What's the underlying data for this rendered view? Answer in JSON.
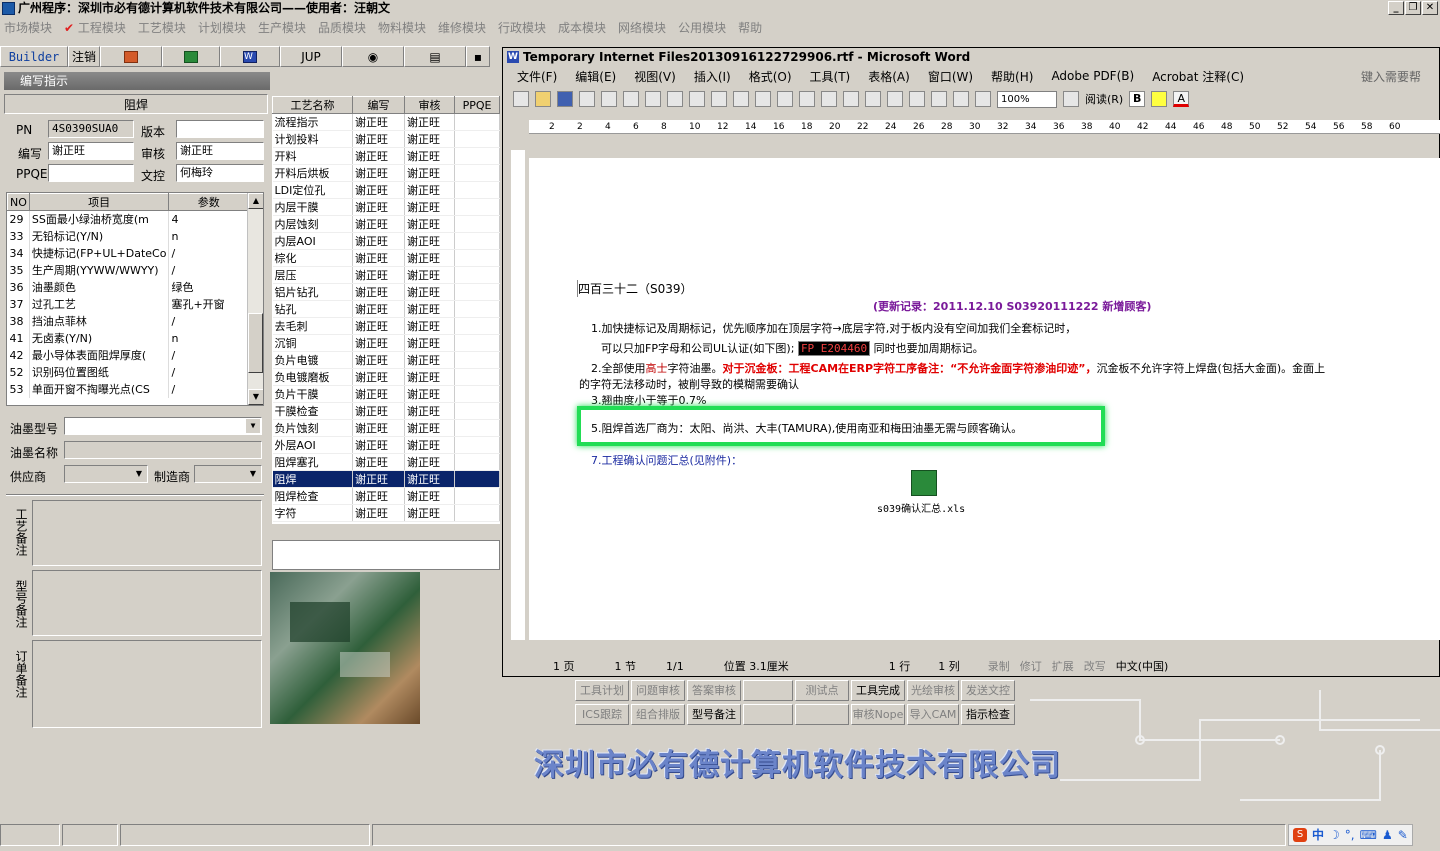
{
  "app": {
    "title": "广州程序：深圳市必有德计算机软件技术有限公司——使用者：汪朝文"
  },
  "menu": [
    "市场模块",
    "工程模块",
    "工艺模块",
    "计划模块",
    "生产模块",
    "品质模块",
    "物料模块",
    "维修模块",
    "行政模块",
    "成本模块",
    "网络模块",
    "公用模块",
    "帮助"
  ],
  "toolbar": {
    "builder": "Builder",
    "logout": "注销",
    "jup": "JUP"
  },
  "left": {
    "header": "编写指示",
    "section_title": "阻焊",
    "pn_label": "PN",
    "pn_value": "4S0390SUA0",
    "version_label": "版本",
    "version_value": "",
    "author_label": "编写",
    "author_value": "谢正旺",
    "review_label": "审核",
    "review_value": "谢正旺",
    "ppqe_label": "PPQE",
    "ppqe_value": "",
    "control_label": "文控",
    "control_value": "何梅玲",
    "param_cols": [
      "NO",
      "项目",
      "参数"
    ],
    "params": [
      {
        "no": "29",
        "item": "SS面最小绿油桥宽度(m",
        "val": "4"
      },
      {
        "no": "33",
        "item": "无铅标记(Y/N)",
        "val": "n"
      },
      {
        "no": "34",
        "item": "快捷标记(FP+UL+DateCo",
        "val": "/"
      },
      {
        "no": "35",
        "item": "生产周期(YYWW/WWYY)",
        "val": "/"
      },
      {
        "no": "36",
        "item": "油墨颜色",
        "val": "绿色"
      },
      {
        "no": "37",
        "item": "过孔工艺",
        "val": "塞孔+开窗"
      },
      {
        "no": "38",
        "item": "挡油点菲林",
        "val": "/"
      },
      {
        "no": "41",
        "item": "无卤素(Y/N)",
        "val": "n"
      },
      {
        "no": "42",
        "item": "最小导体表面阻焊厚度(",
        "val": "/"
      },
      {
        "no": "52",
        "item": "识别码位置图纸",
        "val": "/"
      },
      {
        "no": "53",
        "item": "单面开窗不掏曝光点(CS",
        "val": "/"
      }
    ],
    "ink_type_label": "油墨型号",
    "ink_name_label": "油墨名称",
    "supplier_label": "供应商",
    "maker_label": "制造商",
    "note1": "工艺备注",
    "note2": "型号备注",
    "note3": "订单备注"
  },
  "process": {
    "cols": [
      "工艺名称",
      "编写",
      "审核",
      "PPQE"
    ],
    "rows": [
      [
        "流程指示",
        "谢正旺",
        "谢正旺"
      ],
      [
        "计划投料",
        "谢正旺",
        "谢正旺"
      ],
      [
        "开料",
        "谢正旺",
        "谢正旺"
      ],
      [
        "开料后烘板",
        "谢正旺",
        "谢正旺"
      ],
      [
        "LDI定位孔",
        "谢正旺",
        "谢正旺"
      ],
      [
        "内层干膜",
        "谢正旺",
        "谢正旺"
      ],
      [
        "内层蚀刻",
        "谢正旺",
        "谢正旺"
      ],
      [
        "内层AOI",
        "谢正旺",
        "谢正旺"
      ],
      [
        "棕化",
        "谢正旺",
        "谢正旺"
      ],
      [
        "层压",
        "谢正旺",
        "谢正旺"
      ],
      [
        "铝片钻孔",
        "谢正旺",
        "谢正旺"
      ],
      [
        "钻孔",
        "谢正旺",
        "谢正旺"
      ],
      [
        "去毛刺",
        "谢正旺",
        "谢正旺"
      ],
      [
        "沉铜",
        "谢正旺",
        "谢正旺"
      ],
      [
        "负片电镀",
        "谢正旺",
        "谢正旺"
      ],
      [
        "负电镀磨板",
        "谢正旺",
        "谢正旺"
      ],
      [
        "负片干膜",
        "谢正旺",
        "谢正旺"
      ],
      [
        "干膜检查",
        "谢正旺",
        "谢正旺"
      ],
      [
        "负片蚀刻",
        "谢正旺",
        "谢正旺"
      ],
      [
        "外层AOI",
        "谢正旺",
        "谢正旺"
      ],
      [
        "阻焊塞孔",
        "谢正旺",
        "谢正旺"
      ],
      [
        "阻焊",
        "谢正旺",
        "谢正旺"
      ],
      [
        "阻焊检查",
        "谢正旺",
        "谢正旺"
      ],
      [
        "字符",
        "谢正旺",
        "谢正旺"
      ]
    ],
    "selected_index": 21
  },
  "word": {
    "title": "Temporary Internet Files20130916122729906.rtf - Microsoft Word",
    "menu": [
      "文件(F)",
      "编辑(E)",
      "视图(V)",
      "插入(I)",
      "格式(O)",
      "工具(T)",
      "表格(A)",
      "窗口(W)",
      "帮助(H)",
      "Adobe PDF(B)",
      "Acrobat 注释(C)"
    ],
    "help_hint": "键入需要帮",
    "zoom": "100%",
    "read_label": "阅读(R)",
    "ruler": [
      "2",
      "2",
      "4",
      "6",
      "8",
      "10",
      "12",
      "14",
      "16",
      "18",
      "20",
      "22",
      "24",
      "26",
      "28",
      "30",
      "32",
      "34",
      "36",
      "38",
      "40",
      "42",
      "44",
      "46",
      "48",
      "50",
      "52",
      "54",
      "56",
      "58",
      "60"
    ],
    "doc": {
      "heading": "四百三十二（S039）",
      "update": "(更新记录：2011.12.10      S03920111222      新增顾客)",
      "l1": "1.加快捷标记及周期标记，优先顺序加在顶层字符→底层字符,对于板内没有空间加我们全套标记时，",
      "l1b_pre": "可以只加FP字母和公司UL认证(如下图);",
      "l1b_mark": "FP E204460",
      "l1b_post": "同时也要加周期标记。",
      "l2_pre": "2.全部使用",
      "l2_brand": "高士",
      "l2_mid": "字符油墨。",
      "l2_red": "对于沉金板：工程CAM在ERP字符工序备注：“不允许金面字符渗油印迹”，",
      "l2_tail": "沉金板不允许字符上焊盘(包括大金面)。金面上",
      "l2b": "的字符无法移动时，被削导致的模糊需要确认",
      "l3": "3.翘曲度小于等于0.7%",
      "l5": "5.阻焊首选厂商为：太阳、尚洪、大丰(TAMURA),使用南亚和梅田油墨无需与顾客确认。",
      "l7": "7.工程确认问题汇总(见附件)：",
      "attachment": "s039确认汇总.xls"
    },
    "status": [
      "1 页",
      "1 节",
      "1/1",
      "位置 3.1厘米",
      "1 行",
      "1 列",
      "录制",
      "修订",
      "扩展",
      "改写",
      "中文(中国)"
    ]
  },
  "buttons": {
    "row1": [
      "工具计划",
      "问题审核",
      "答案审核",
      "",
      "测试点",
      "工具完成",
      "光绘审核",
      "发送文控"
    ],
    "row2": [
      "ICS跟踪",
      "组合排版",
      "型号备注",
      "",
      "",
      "审核Nope",
      "导入CAM",
      "指示检查"
    ]
  },
  "banner": "深圳市必有德计算机软件技术有限公司",
  "ime": {
    "label": "中"
  }
}
